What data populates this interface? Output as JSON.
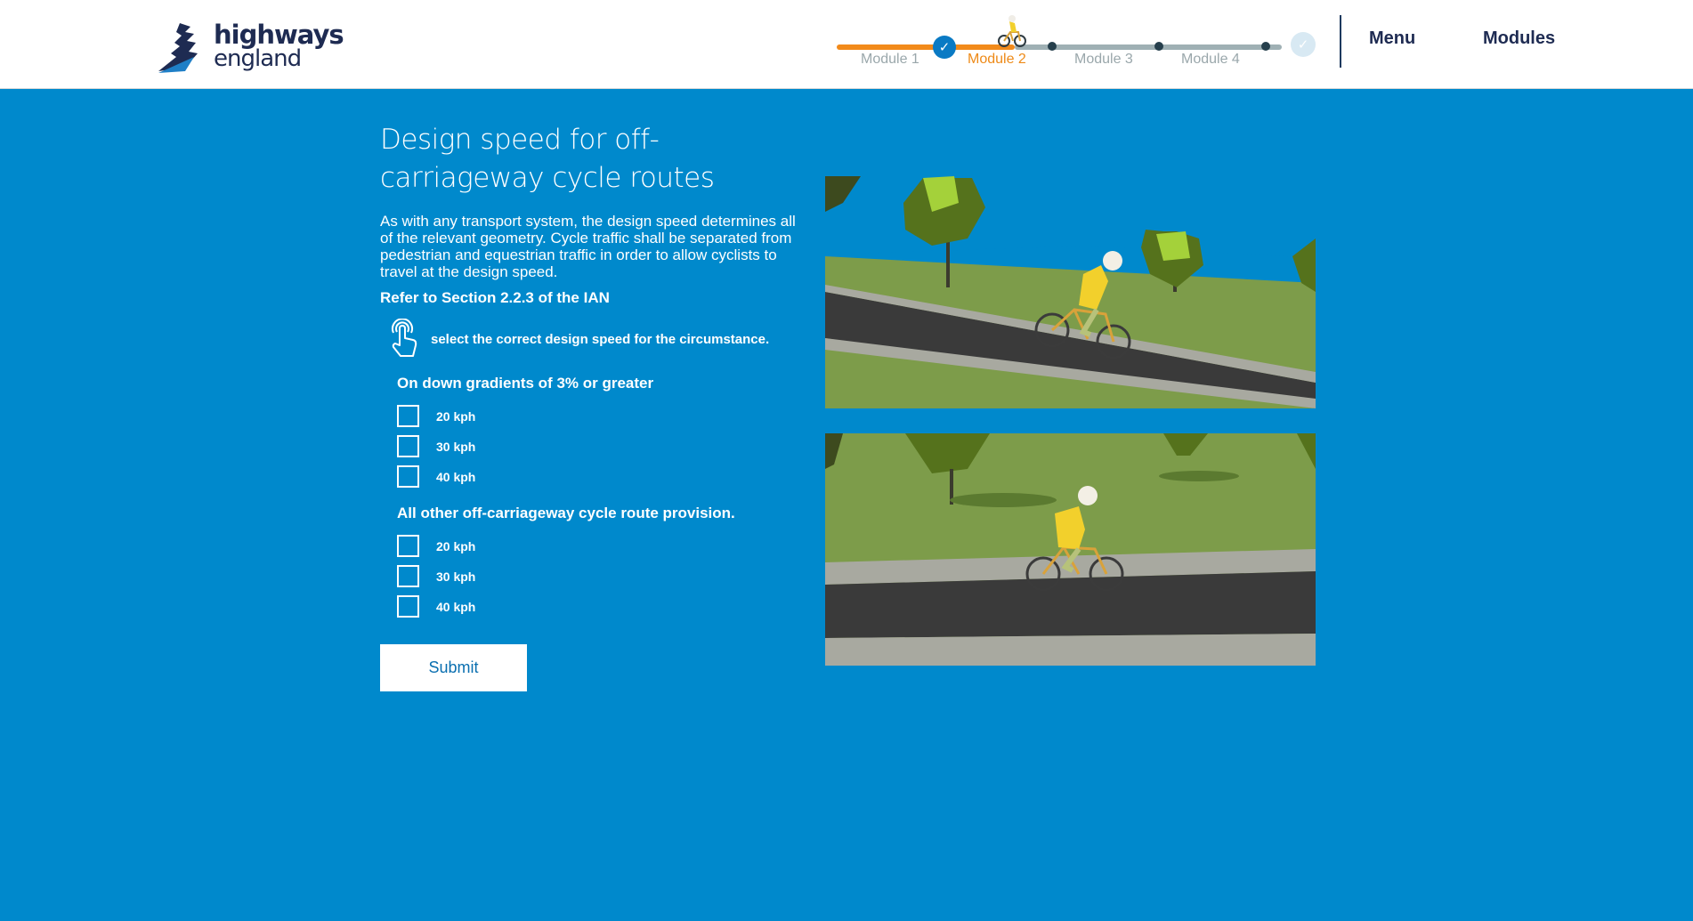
{
  "header": {
    "logo_line1": "highways",
    "logo_line2": "england",
    "progress": {
      "modules": [
        {
          "label": "Module 1",
          "state": "complete"
        },
        {
          "label": "Module 2",
          "state": "current"
        },
        {
          "label": "Module 3",
          "state": "upcoming"
        },
        {
          "label": "Module 4",
          "state": "upcoming"
        }
      ],
      "done_color": "#f28a1a",
      "todo_color": "#9fb0b4",
      "current_color": "#ee8a18"
    },
    "nav": {
      "menu_label": "Menu",
      "modules_label": "Modules"
    }
  },
  "content": {
    "title": "Design speed for off-carriageway cycle routes",
    "intro": "As with any transport system, the design speed determines all of the relevant geometry. Cycle traffic shall be separated from pedestrian and equestrian traffic in order to allow cyclists to travel at the design speed.",
    "reference": "Refer to Section 2.2.3 of the IAN",
    "instruction": "select the correct design speed for the circumstance.",
    "instruction_icon": "hand-tap-icon",
    "questions": [
      {
        "heading": "On down gradients of 3% or greater",
        "options": [
          "20 kph",
          "30 kph",
          "40 kph"
        ]
      },
      {
        "heading": "All other off-carriageway cycle route provision.",
        "options": [
          "20 kph",
          "30 kph",
          "40 kph"
        ]
      }
    ],
    "submit_label": "Submit"
  },
  "theme": {
    "background": "#0089cc",
    "header_bg": "#ffffff",
    "navy": "#1e2b52"
  }
}
